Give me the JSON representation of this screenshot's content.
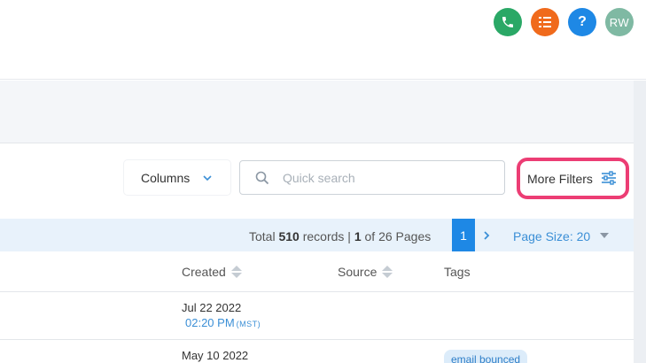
{
  "header": {
    "buttons": [
      {
        "icon": "phone-icon",
        "color": "#2aa866"
      },
      {
        "icon": "task-list-icon",
        "color": "#f06a1c"
      },
      {
        "icon": "help-icon",
        "label": "?",
        "color": "#1e88e5"
      },
      {
        "icon": "avatar",
        "label": "RW",
        "color": "#7fb9a3"
      }
    ]
  },
  "toolbar": {
    "columns_label": "Columns",
    "search_placeholder": "Quick search",
    "more_filters_label": "More Filters",
    "highlight_color": "#ec3d74"
  },
  "pagination": {
    "total_prefix": "Total ",
    "total_records": "510",
    "records_word": " records | ",
    "current_page": "1",
    "of_text": " of 26 Pages",
    "page_button": "1",
    "page_size_label": "Page Size: 20"
  },
  "table": {
    "columns": [
      "Created",
      "Source",
      "Tags"
    ],
    "rows": [
      {
        "date": "Jul 22 2022",
        "time": "02:20 PM",
        "tz": "(MST)",
        "tags": []
      },
      {
        "date": "May 10 2022",
        "time": "",
        "tz": "",
        "tags": [
          "email bounced"
        ]
      }
    ]
  }
}
